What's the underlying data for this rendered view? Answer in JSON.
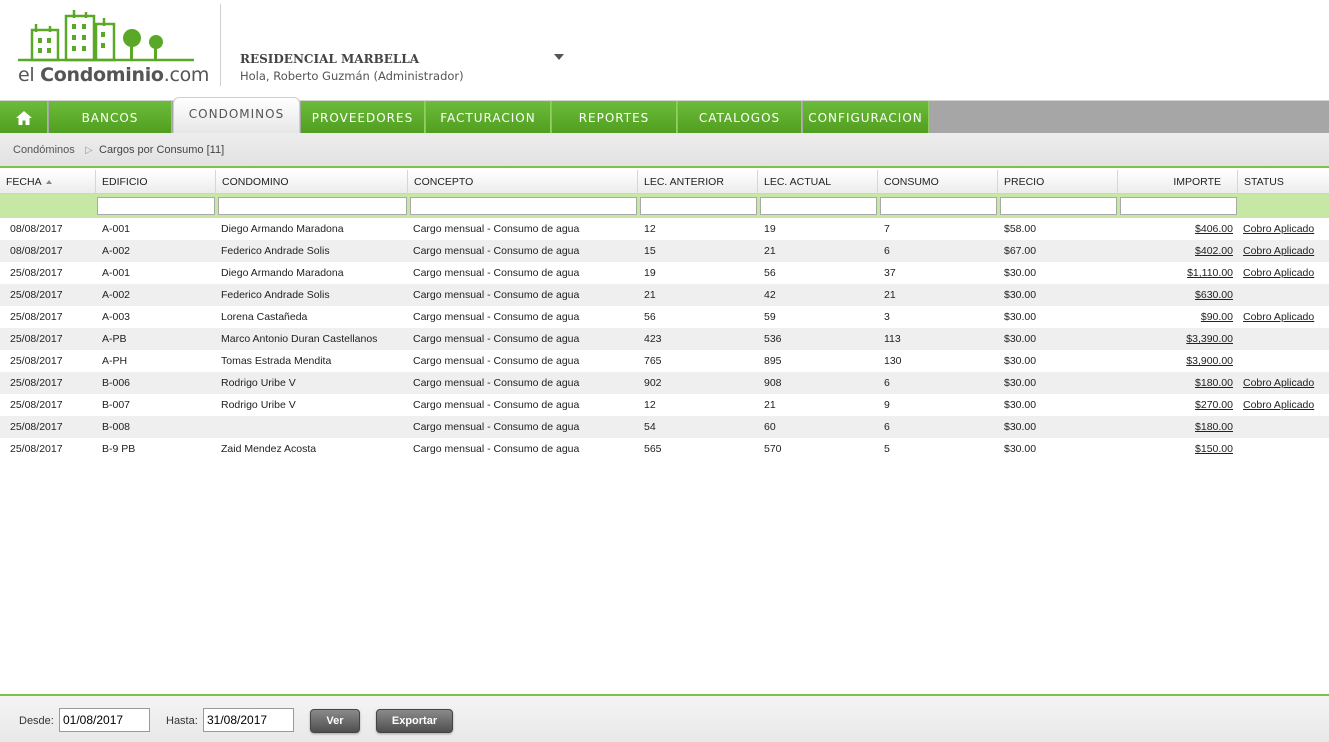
{
  "brand": {
    "logo_text_light": "el ",
    "logo_text_bold": "Condominio",
    "logo_text_suffix": ".com",
    "accent": "#5aa828"
  },
  "header": {
    "condo_name": "RESIDENCIAL MARBELLA",
    "greeting": "Hola, Roberto Guzmán (Administrador)"
  },
  "nav": {
    "home_icon": "home-icon",
    "items": [
      {
        "label": "BANCOS"
      },
      {
        "label": "CONDOMINOS"
      },
      {
        "label": "PROVEEDORES"
      },
      {
        "label": "FACTURACION"
      },
      {
        "label": "REPORTES"
      },
      {
        "label": "CATALOGOS"
      },
      {
        "label": "CONFIGURACION"
      }
    ],
    "active": "CONDOMINOS"
  },
  "breadcrumb": {
    "root": "Condóminos",
    "current": "Cargos por Consumo [11]"
  },
  "table": {
    "columns": [
      "FECHA",
      "EDIFICIO",
      "CONDOMINO",
      "CONCEPTO",
      "LEC. ANTERIOR",
      "LEC. ACTUAL",
      "CONSUMO",
      "PRECIO",
      "IMPORTE",
      "STATUS"
    ],
    "rows": [
      [
        "08/08/2017",
        "A-001",
        "Diego Armando Maradona",
        "Cargo mensual - Consumo de agua",
        "12",
        "19",
        "7",
        "$58.00",
        "$406.00",
        "Cobro Aplicado"
      ],
      [
        "08/08/2017",
        "A-002",
        "Federico Andrade Solis",
        "Cargo mensual - Consumo de agua",
        "15",
        "21",
        "6",
        "$67.00",
        "$402.00",
        "Cobro Aplicado"
      ],
      [
        "25/08/2017",
        "A-001",
        "Diego Armando Maradona",
        "Cargo mensual - Consumo de agua",
        "19",
        "56",
        "37",
        "$30.00",
        "$1,110.00",
        "Cobro Aplicado"
      ],
      [
        "25/08/2017",
        "A-002",
        "Federico Andrade Solis",
        "Cargo mensual - Consumo de agua",
        "21",
        "42",
        "21",
        "$30.00",
        "$630.00",
        ""
      ],
      [
        "25/08/2017",
        "A-003",
        "Lorena Castañeda",
        "Cargo mensual - Consumo de agua",
        "56",
        "59",
        "3",
        "$30.00",
        "$90.00",
        "Cobro Aplicado"
      ],
      [
        "25/08/2017",
        "A-PB",
        "Marco Antonio Duran Castellanos",
        "Cargo mensual - Consumo de agua",
        "423",
        "536",
        "113",
        "$30.00",
        "$3,390.00",
        ""
      ],
      [
        "25/08/2017",
        "A-PH",
        "Tomas Estrada Mendita",
        "Cargo mensual - Consumo de agua",
        "765",
        "895",
        "130",
        "$30.00",
        "$3,900.00",
        ""
      ],
      [
        "25/08/2017",
        "B-006",
        "Rodrigo Uribe V",
        "Cargo mensual - Consumo de agua",
        "902",
        "908",
        "6",
        "$30.00",
        "$180.00",
        "Cobro Aplicado"
      ],
      [
        "25/08/2017",
        "B-007",
        "Rodrigo Uribe V",
        "Cargo mensual - Consumo de agua",
        "12",
        "21",
        "9",
        "$30.00",
        "$270.00",
        "Cobro Aplicado"
      ],
      [
        "25/08/2017",
        "B-008",
        "",
        "Cargo mensual - Consumo de agua",
        "54",
        "60",
        "6",
        "$30.00",
        "$180.00",
        ""
      ],
      [
        "25/08/2017",
        "B-9 PB",
        "Zaid Mendez Acosta",
        "Cargo mensual - Consumo de agua",
        "565",
        "570",
        "5",
        "$30.00",
        "$150.00",
        ""
      ]
    ]
  },
  "footer": {
    "desde_label": "Desde:",
    "desde_value": "01/08/2017",
    "hasta_label": "Hasta:",
    "hasta_value": "31/08/2017",
    "ver_label": "Ver",
    "exportar_label": "Exportar"
  }
}
